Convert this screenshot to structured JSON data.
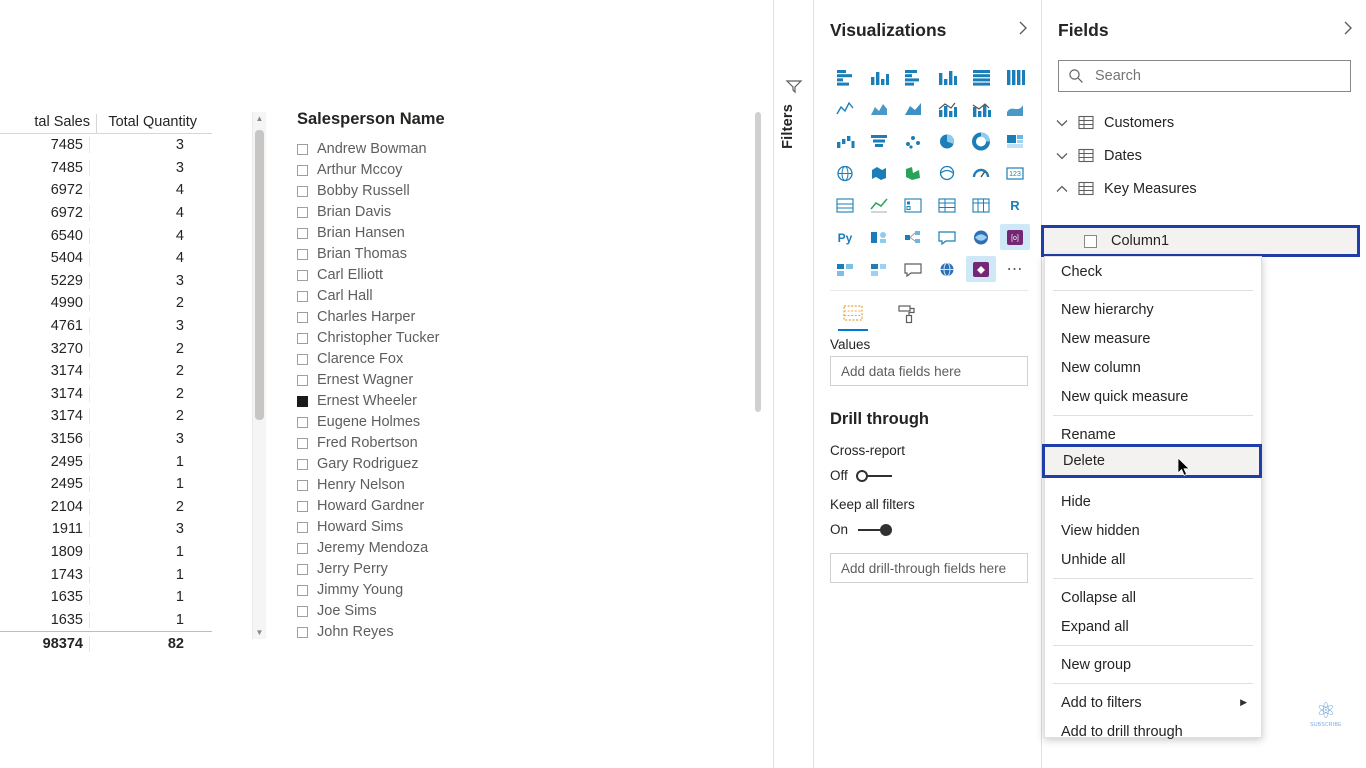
{
  "canvas": {
    "table": {
      "headers": [
        "tal Sales",
        "Total Quantity"
      ],
      "rows": [
        {
          "sales": "7485",
          "qty": "3"
        },
        {
          "sales": "7485",
          "qty": "3"
        },
        {
          "sales": "6972",
          "qty": "4"
        },
        {
          "sales": "6972",
          "qty": "4"
        },
        {
          "sales": "6540",
          "qty": "4"
        },
        {
          "sales": "5404",
          "qty": "4"
        },
        {
          "sales": "5229",
          "qty": "3"
        },
        {
          "sales": "4990",
          "qty": "2"
        },
        {
          "sales": "4761",
          "qty": "3"
        },
        {
          "sales": "3270",
          "qty": "2"
        },
        {
          "sales": "3174",
          "qty": "2"
        },
        {
          "sales": "3174",
          "qty": "2"
        },
        {
          "sales": "3174",
          "qty": "2"
        },
        {
          "sales": "3156",
          "qty": "3"
        },
        {
          "sales": "2495",
          "qty": "1"
        },
        {
          "sales": "2495",
          "qty": "1"
        },
        {
          "sales": "2104",
          "qty": "2"
        },
        {
          "sales": "1911",
          "qty": "3"
        },
        {
          "sales": "1809",
          "qty": "1"
        },
        {
          "sales": "1743",
          "qty": "1"
        },
        {
          "sales": "1635",
          "qty": "1"
        },
        {
          "sales": "1635",
          "qty": "1"
        }
      ],
      "total": {
        "sales": "98374",
        "qty": "82"
      }
    },
    "slicer": {
      "title": "Salesperson Name",
      "items": [
        {
          "label": "Andrew Bowman",
          "checked": false
        },
        {
          "label": "Arthur Mccoy",
          "checked": false
        },
        {
          "label": "Bobby Russell",
          "checked": false
        },
        {
          "label": "Brian Davis",
          "checked": false
        },
        {
          "label": "Brian Hansen",
          "checked": false
        },
        {
          "label": "Brian Thomas",
          "checked": false
        },
        {
          "label": "Carl Elliott",
          "checked": false
        },
        {
          "label": "Carl Hall",
          "checked": false
        },
        {
          "label": "Charles Harper",
          "checked": false
        },
        {
          "label": "Christopher Tucker",
          "checked": false
        },
        {
          "label": "Clarence Fox",
          "checked": false
        },
        {
          "label": "Ernest Wagner",
          "checked": false
        },
        {
          "label": "Ernest Wheeler",
          "checked": true
        },
        {
          "label": "Eugene Holmes",
          "checked": false
        },
        {
          "label": "Fred Robertson",
          "checked": false
        },
        {
          "label": "Gary Rodriguez",
          "checked": false
        },
        {
          "label": "Henry Nelson",
          "checked": false
        },
        {
          "label": "Howard Gardner",
          "checked": false
        },
        {
          "label": "Howard Sims",
          "checked": false
        },
        {
          "label": "Jeremy Mendoza",
          "checked": false
        },
        {
          "label": "Jerry Perry",
          "checked": false
        },
        {
          "label": "Jimmy Young",
          "checked": false
        },
        {
          "label": "Joe Sims",
          "checked": false
        },
        {
          "label": "John Reyes",
          "checked": false
        }
      ]
    }
  },
  "filters_pane": {
    "label": "Filters",
    "icon": "filter-icon"
  },
  "visualizations": {
    "title": "Visualizations",
    "expand_icon": "chevron-right-icon",
    "collapse_icon": "chevron-left-icon",
    "more_label": "• • •",
    "field_wells": {
      "values_label": "Values",
      "values_placeholder": "Add data fields here",
      "fields_tab_icon": "fields-icon",
      "format_tab_icon": "paint-roller-icon"
    },
    "drill_through": {
      "title": "Drill through",
      "cross_report_label": "Cross-report",
      "cross_report_state": "Off",
      "keep_filters_label": "Keep all filters",
      "keep_filters_state": "On",
      "drop_placeholder": "Add drill-through fields here"
    }
  },
  "fields": {
    "title": "Fields",
    "expand_icon": "chevron-right-icon",
    "search": {
      "placeholder": "Search",
      "value": "",
      "icon": "search-icon"
    },
    "tables": [
      {
        "name": "Customers",
        "expanded": false
      },
      {
        "name": "Dates",
        "expanded": false
      },
      {
        "name": "Key Measures",
        "expanded": true
      }
    ],
    "selected_field": {
      "name": "Column1",
      "checked": false,
      "highlight_color": "#1f3ea8"
    }
  },
  "context_menu": {
    "items": [
      {
        "label": "Check",
        "submenu": false
      },
      {
        "label": "New hierarchy",
        "submenu": false
      },
      {
        "label": "New measure",
        "submenu": false
      },
      {
        "label": "New column",
        "submenu": false
      },
      {
        "label": "New quick measure",
        "submenu": false
      },
      {
        "label": "Rename",
        "submenu": false
      },
      {
        "label": "Delete",
        "submenu": false
      },
      {
        "label": "Hide",
        "submenu": false
      },
      {
        "label": "View hidden",
        "submenu": false
      },
      {
        "label": "Unhide all",
        "submenu": false
      },
      {
        "label": "Collapse all",
        "submenu": false
      },
      {
        "label": "Expand all",
        "submenu": false
      },
      {
        "label": "New group",
        "submenu": false
      },
      {
        "label": "Add to filters",
        "submenu": true
      },
      {
        "label": "Add to drill through",
        "submenu": false
      }
    ],
    "highlighted": "Delete",
    "highlight_color": "#1f3ea8"
  },
  "watermark": {
    "label": "SUBSCRIBE"
  }
}
